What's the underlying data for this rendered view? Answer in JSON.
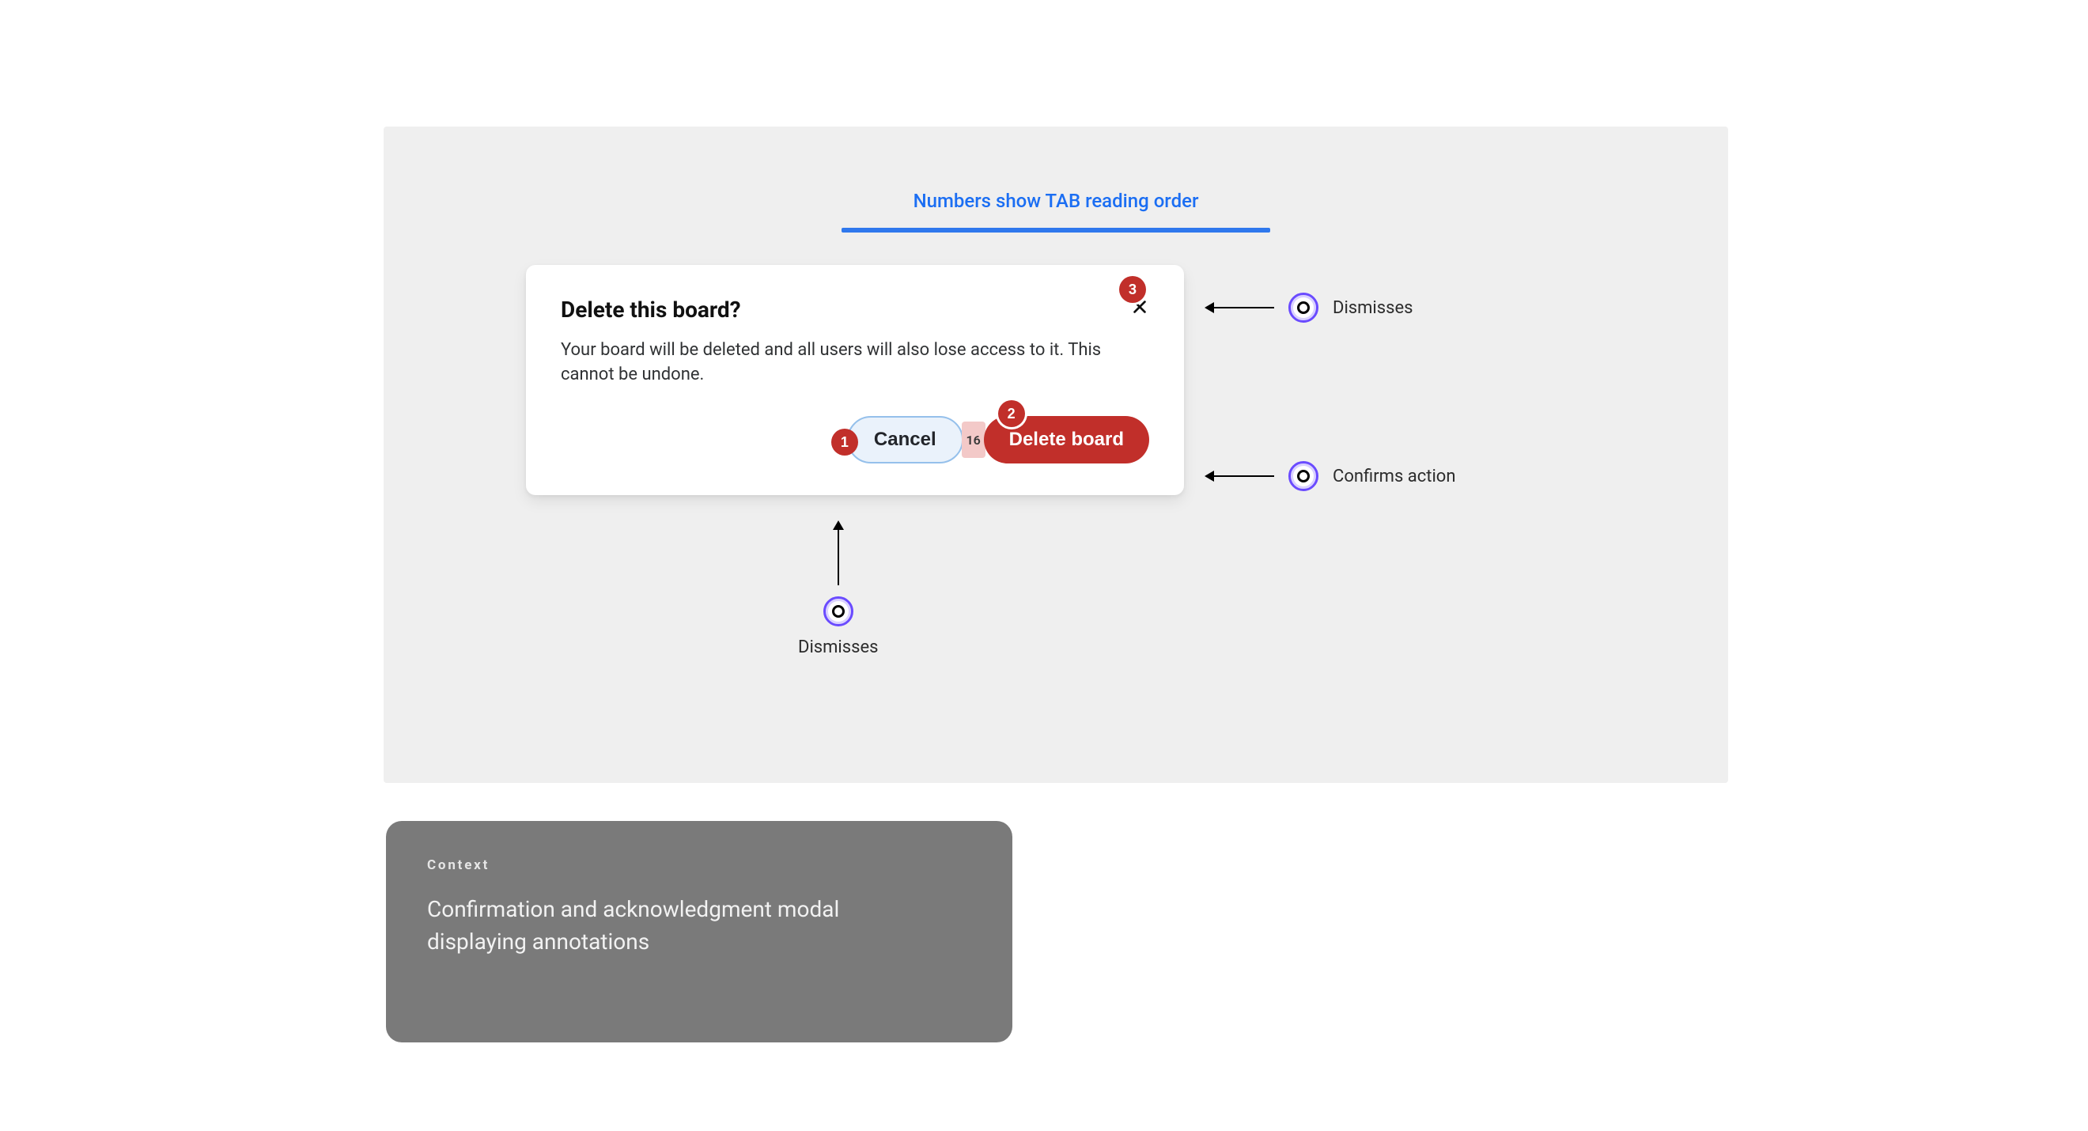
{
  "stage": {
    "caption": "Numbers show TAB reading order"
  },
  "dialog": {
    "title": "Delete this board?",
    "body": "Your board will be deleted and all users will also lose access to it. This cannot be undone.",
    "actions": {
      "cancel": {
        "label": "Cancel",
        "tab_order": "1"
      },
      "spacer_value": "16",
      "confirm": {
        "label": "Delete board",
        "tab_order": "2"
      }
    },
    "close": {
      "tab_order": "3"
    }
  },
  "callouts": {
    "close": "Dismisses",
    "confirm": "Confirms action",
    "cancel": "Dismisses"
  },
  "context_card": {
    "eyebrow": "Context",
    "body": "Confirmation and acknowledgment modal displaying annotations"
  }
}
